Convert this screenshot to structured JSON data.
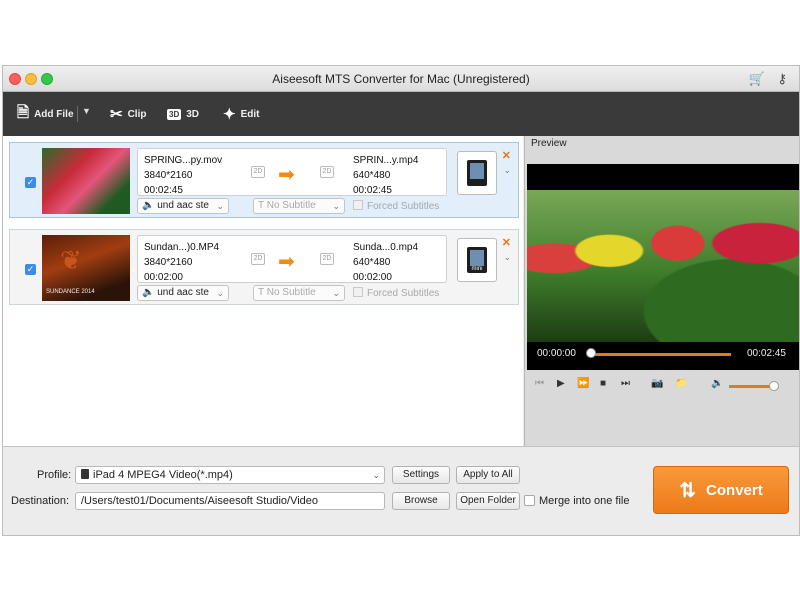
{
  "window": {
    "title": "Aiseesoft MTS Converter for Mac (Unregistered)"
  },
  "toolbar": {
    "add_file": "Add File",
    "clip": "Clip",
    "three_d": "3D",
    "three_d_badge": "3D",
    "edit": "Edit"
  },
  "files": [
    {
      "checked": true,
      "src_name": "SPRING...py.mov",
      "src_res": "3840*2160",
      "src_dur": "00:02:45",
      "badge_2d": "2D",
      "dst_name": "SPRIN...y.mp4",
      "dst_res": "640*480",
      "dst_dur": "00:02:45",
      "device_label": "",
      "audio": "und aac ste",
      "subtitle": "No Subtitle",
      "forced": "Forced Subtitles"
    },
    {
      "checked": true,
      "src_name": "Sundan...)0.MP4",
      "src_res": "3840*2160",
      "src_dur": "00:02:00",
      "badge_2d": "2D",
      "dst_name": "Sunda...0.mp4",
      "dst_res": "640*480",
      "dst_dur": "00:02:00",
      "device_label": "mini",
      "audio": "und aac ste",
      "subtitle": "No Subtitle",
      "forced": "Forced Subtitles",
      "thumb_caption": "SUNDANCE 2014"
    }
  ],
  "preview": {
    "label": "Preview",
    "current_time": "00:00:00",
    "total_time": "00:02:45",
    "progress": 0,
    "volume": 0.9
  },
  "bottom": {
    "profile_label": "Profile:",
    "profile_value": "iPad 4 MPEG4 Video(*.mp4)",
    "settings": "Settings",
    "apply_all": "Apply to All",
    "destination_label": "Destination:",
    "destination_value": "/Users/test01/Documents/Aiseesoft Studio/Video",
    "browse": "Browse",
    "open_folder": "Open Folder",
    "merge": "Merge into one file",
    "convert": "Convert"
  },
  "colors": {
    "accent": "#f18a17",
    "toolbar_bg": "#3a3a3a",
    "selected_row": "#e2eefa"
  }
}
